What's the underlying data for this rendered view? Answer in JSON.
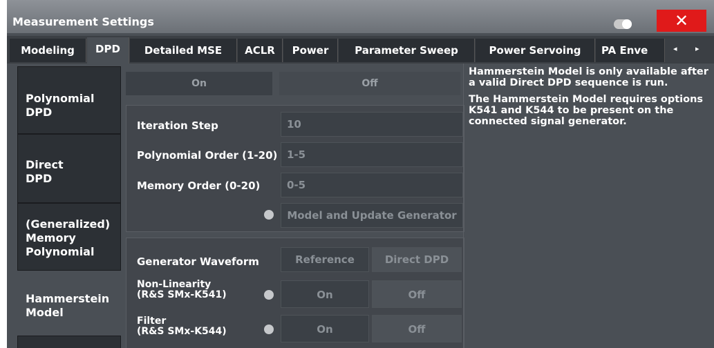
{
  "window": {
    "title": "Measurement Settings",
    "close_label": "✕"
  },
  "tabs": [
    {
      "label": "Modeling",
      "active": false
    },
    {
      "label": "DPD",
      "active": true
    },
    {
      "label": "Detailed MSE",
      "active": false
    },
    {
      "label": "ACLR",
      "active": false
    },
    {
      "label": "Power",
      "active": false
    },
    {
      "label": "Parameter Sweep",
      "active": false
    },
    {
      "label": "Power Servoing",
      "active": false
    },
    {
      "label": "PA Enve",
      "active": false
    }
  ],
  "tab_scroll": {
    "left": "◂",
    "right": "▸"
  },
  "sidebar": {
    "items": [
      {
        "label_lines": [
          "Polynomial",
          "DPD"
        ]
      },
      {
        "label_lines": [
          "Direct",
          "DPD"
        ]
      },
      {
        "label_lines": [
          "(Generalized)",
          "Memory",
          "Polynomial"
        ]
      },
      {
        "label_lines": [
          "Hammerstein",
          "Model"
        ],
        "active": true
      }
    ]
  },
  "state_toggle": {
    "on": "On",
    "off": "Off"
  },
  "iteration": {
    "step_label": "Iteration Step",
    "step_value": "10",
    "poly_label": "Polynomial Order (1-20)",
    "poly_value": "1-5",
    "memory_label": "Memory Order (0-20)",
    "memory_value": "0-5",
    "model_update_label": "Model and Update Generator"
  },
  "generator": {
    "waveform_label": "Generator Waveform",
    "waveform_reference": "Reference",
    "waveform_direct": "Direct DPD",
    "nonlin_label_1": "Non-Linearity",
    "nonlin_label_2": "(R&S SMx-K541)",
    "nonlin_on": "On",
    "nonlin_off": "Off",
    "filter_label_1": "Filter",
    "filter_label_2": "(R&S SMx-K544)",
    "filter_on": "On",
    "filter_off": "Off"
  },
  "info": {
    "para1": "Hammerstein Model is only available after a valid Direct DPD sequence is run.",
    "para2": "The Hammerstein Model requires options K541 and K544 to be present on the connected signal generator."
  },
  "colors": {
    "close": "#e01a1a",
    "panel_bg": "#4a4f55"
  }
}
